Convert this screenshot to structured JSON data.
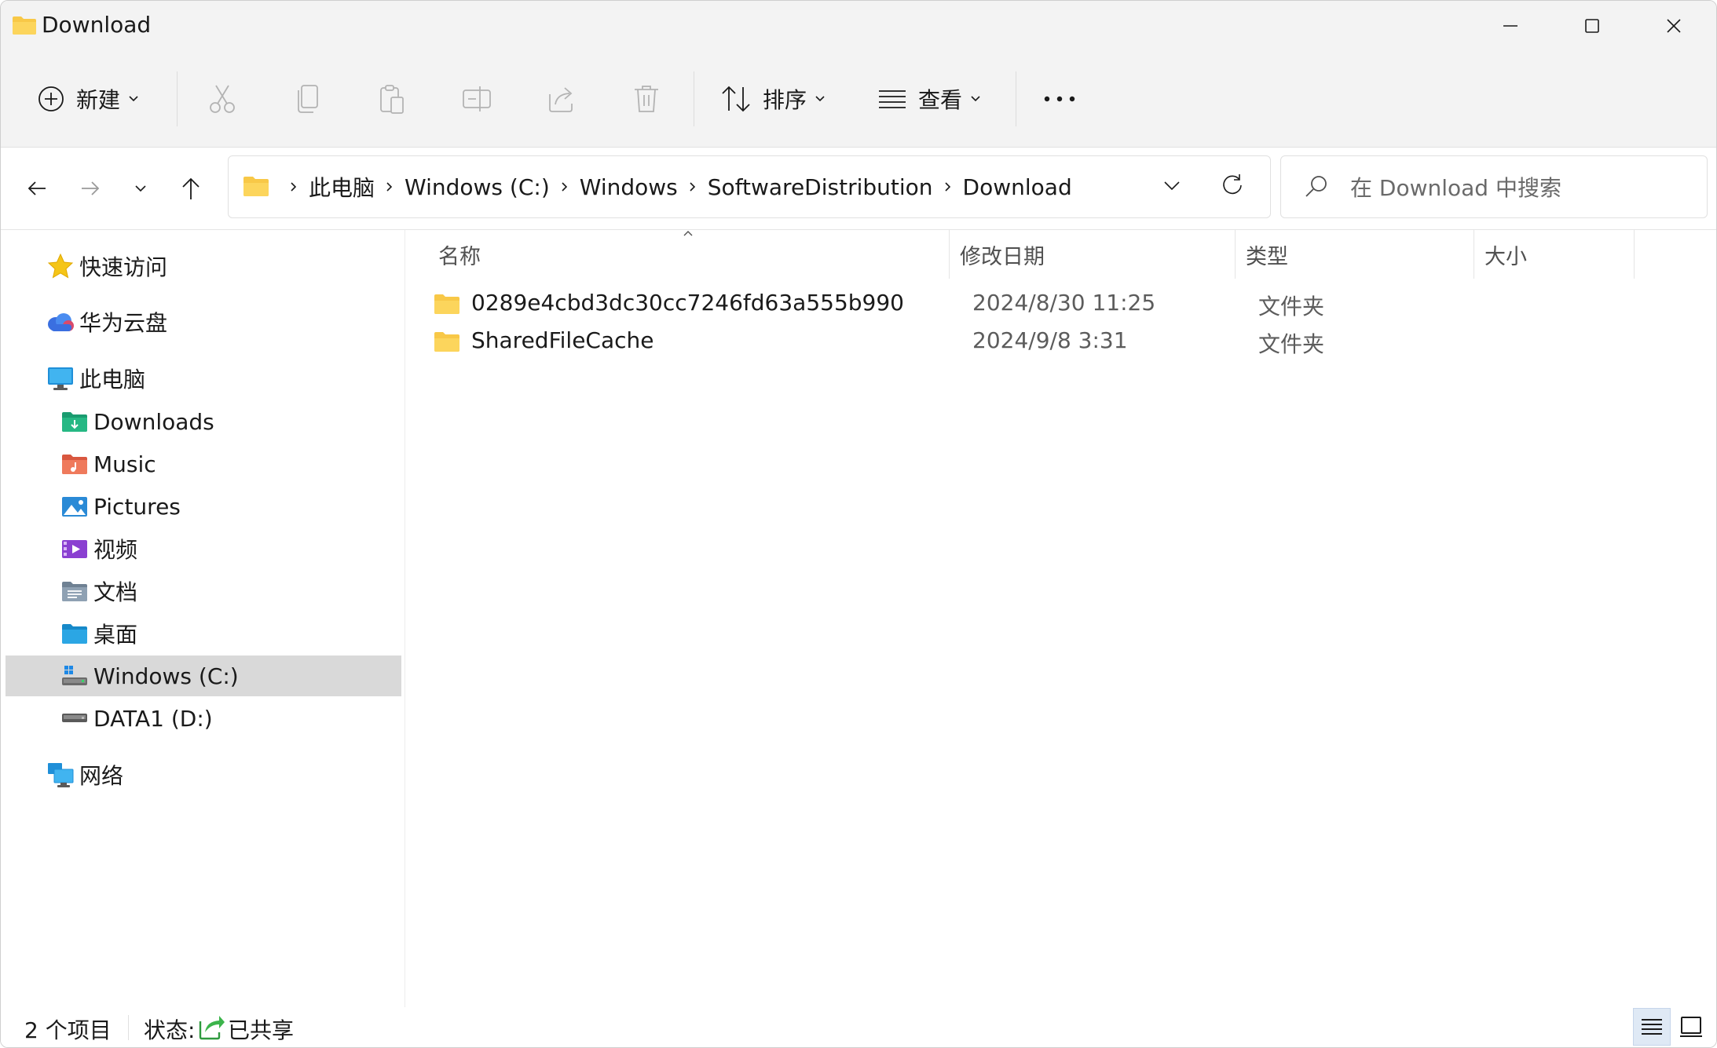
{
  "window": {
    "title": "Download"
  },
  "toolbar": {
    "new_label": "新建",
    "sort_label": "排序",
    "view_label": "查看"
  },
  "address": {
    "crumbs": [
      "此电脑",
      "Windows (C:)",
      "Windows",
      "SoftwareDistribution",
      "Download"
    ]
  },
  "search": {
    "placeholder": "在 Download 中搜索"
  },
  "sidebar": {
    "quick_access": "快速访问",
    "cloud": "华为云盘",
    "this_pc": "此电脑",
    "items": [
      {
        "label": "Downloads"
      },
      {
        "label": "Music"
      },
      {
        "label": "Pictures"
      },
      {
        "label": "视频"
      },
      {
        "label": "文档"
      },
      {
        "label": "桌面"
      },
      {
        "label": "Windows (C:)"
      },
      {
        "label": "DATA1 (D:)"
      }
    ],
    "network": "网络",
    "selected": "Windows (C:)"
  },
  "columns": {
    "name": "名称",
    "date": "修改日期",
    "type": "类型",
    "size": "大小"
  },
  "files": [
    {
      "name": "0289e4cbd3dc30cc7246fd63a555b990",
      "date": "2024/8/30 11:25",
      "type": "文件夹"
    },
    {
      "name": "SharedFileCache",
      "date": "2024/9/8 3:31",
      "type": "文件夹"
    }
  ],
  "status": {
    "count": "2 个项目",
    "state_label": "状态:",
    "state_value": "已共享"
  },
  "colors": {
    "folder": "#f8c847",
    "selected_bg": "#d9d9d9",
    "accent": "#0067c0"
  }
}
